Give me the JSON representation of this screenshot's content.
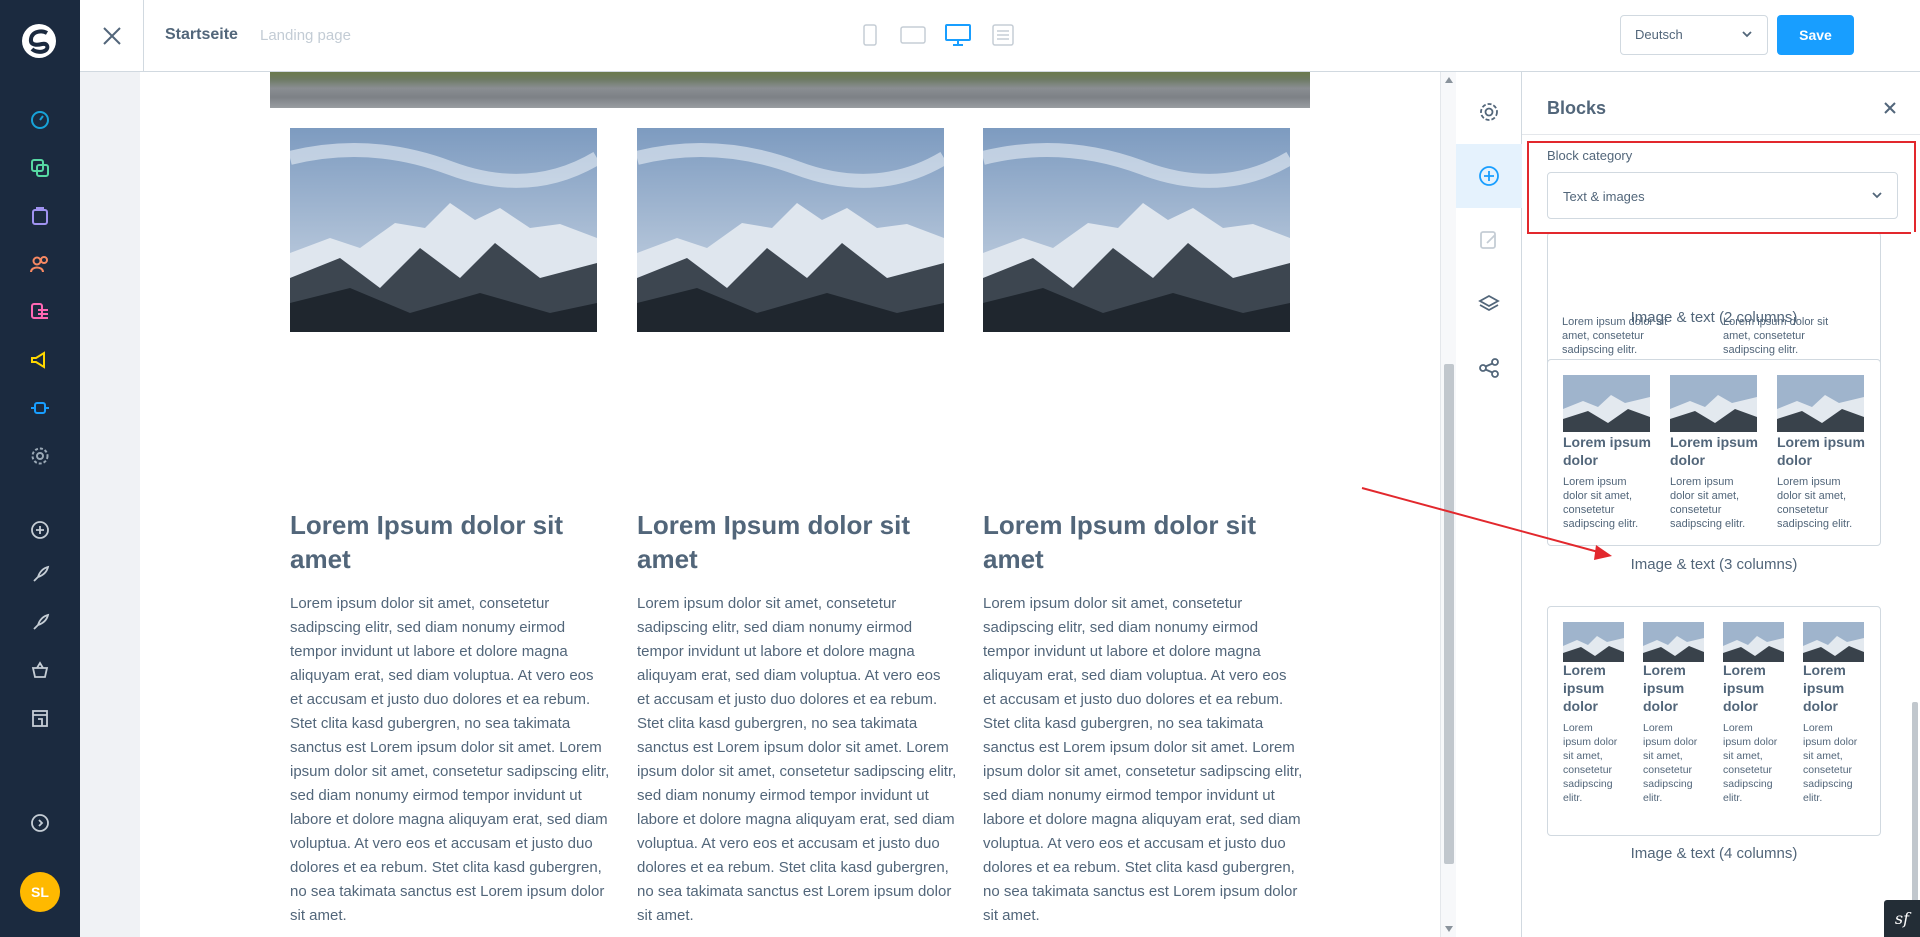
{
  "topbar": {
    "page_name": "Startseite",
    "page_type": "Landing page",
    "language": "Deutsch",
    "save_label": "Save"
  },
  "canvas": {
    "columns": [
      {
        "title": "Lorem Ipsum dolor sit amet",
        "text": "Lorem ipsum dolor sit amet, consetetur sadipscing elitr, sed diam nonumy eirmod tempor invidunt ut labore et dolore magna aliquyam erat, sed diam voluptua. At vero eos et accusam et justo duo dolores et ea rebum. Stet clita kasd gubergren, no sea takimata sanctus est Lorem ipsum dolor sit amet. Lorem ipsum dolor sit amet, consetetur sadipscing elitr, sed diam nonumy eirmod tempor invidunt ut labore et dolore magna aliquyam erat, sed diam voluptua. At vero eos et accusam et justo duo dolores et ea rebum. Stet clita kasd gubergren, no sea takimata sanctus est Lorem ipsum dolor sit amet."
      },
      {
        "title": "Lorem Ipsum dolor sit amet",
        "text": "Lorem ipsum dolor sit amet, consetetur sadipscing elitr, sed diam nonumy eirmod tempor invidunt ut labore et dolore magna aliquyam erat, sed diam voluptua. At vero eos et accusam et justo duo dolores et ea rebum. Stet clita kasd gubergren, no sea takimata sanctus est Lorem ipsum dolor sit amet. Lorem ipsum dolor sit amet, consetetur sadipscing elitr, sed diam nonumy eirmod tempor invidunt ut labore et dolore magna aliquyam erat, sed diam voluptua. At vero eos et accusam et justo duo dolores et ea rebum. Stet clita kasd gubergren, no sea takimata sanctus est Lorem ipsum dolor sit amet."
      },
      {
        "title": "Lorem Ipsum dolor sit amet",
        "text": "Lorem ipsum dolor sit amet, consetetur sadipscing elitr, sed diam nonumy eirmod tempor invidunt ut labore et dolore magna aliquyam erat, sed diam voluptua. At vero eos et accusam et justo duo dolores et ea rebum. Stet clita kasd gubergren, no sea takimata sanctus est Lorem ipsum dolor sit amet. Lorem ipsum dolor sit amet, consetetur sadipscing elitr, sed diam nonumy eirmod tempor invidunt ut labore et dolore magna aliquyam erat, sed diam voluptua. At vero eos et accusam et justo duo dolores et ea rebum. Stet clita kasd gubergren, no sea takimata sanctus est Lorem ipsum dolor sit amet."
      }
    ]
  },
  "user": {
    "initials": "SL"
  },
  "panel": {
    "title": "Blocks",
    "category_label": "Block category",
    "category_value": "Text & images",
    "blocks": [
      {
        "caption": "Image & text (2 columns)",
        "texts": [
          "Lorem ipsum dolor sit amet, consetetur sadipscing elitr.",
          "Lorem ipsum dolor sit amet, consetetur sadipscing elitr."
        ]
      },
      {
        "caption": "Image & text (3 columns)",
        "mini_title": "Lorem ipsum dolor",
        "mini_text": "Lorem ipsum dolor sit amet, consetetur sadipscing elitr."
      },
      {
        "caption": "Image & text (4 columns)",
        "mini_title": "Lorem ipsum dolor",
        "mini_text": "Lorem ipsum dolor sit amet, consetetur sadipscing elitr."
      }
    ]
  },
  "badge": {
    "label": "sf"
  },
  "colors": {
    "nav_bg": "#1b2a3f",
    "accent": "#189eff",
    "avatar": "#ffb900",
    "highlight": "#e2282d"
  },
  "icons": {
    "nav": [
      "dashboard-icon",
      "catalogue-icon",
      "orders-icon",
      "customers-icon",
      "content-icon",
      "marketing-icon",
      "extensions-icon",
      "settings-icon",
      "add-icon",
      "rocket-icon",
      "rocket-icon",
      "shop-icon",
      "storefront-icon",
      "help-icon"
    ],
    "toolbar": [
      "settings-icon",
      "add-block-icon",
      "edit-icon",
      "layers-icon",
      "share-icon"
    ]
  }
}
